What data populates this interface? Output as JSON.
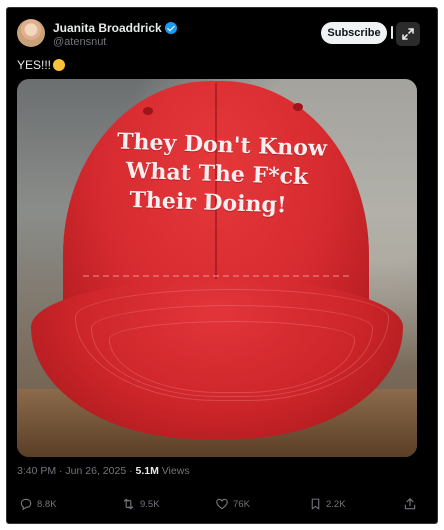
{
  "author": {
    "name": "Juanita Broaddrick",
    "handle": "@atensnut",
    "verified": true
  },
  "header": {
    "subscribe_label": "Subscribe",
    "expand_icon": "expand-icon"
  },
  "post": {
    "text": "YES!!!",
    "emoji": "rolling-on-the-floor-laughing-emoji",
    "image": {
      "description_icon": "red-cap-photo",
      "cap_text_lines": [
        "They Don't Know",
        "What The F*ck",
        "Their Doing!"
      ]
    },
    "time": "3:40 PM · Jun 26, 2025 · ",
    "views_count": "5.1M",
    "views_label": " Views"
  },
  "actions": {
    "replies": "8.8K",
    "reposts": "9.5K",
    "likes": "76K",
    "bookmarks": "2.2K",
    "share_icon": "share-icon"
  },
  "colors": {
    "background": "#000000",
    "text_primary": "#e7e9ea",
    "text_secondary": "#71767b",
    "verified_blue": "#1d9bf0",
    "cap_red": "#d52a2f"
  }
}
